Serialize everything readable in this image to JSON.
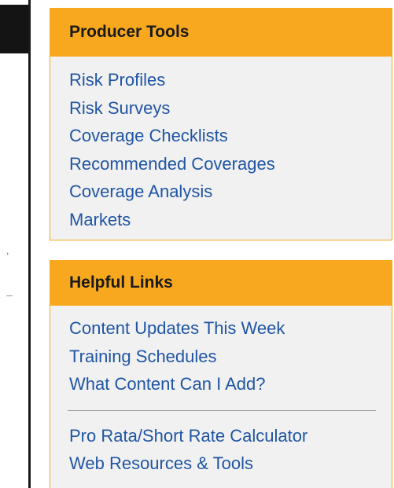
{
  "producer_tools": {
    "title": "Producer Tools",
    "links": [
      "Risk Profiles",
      "Risk Surveys",
      "Coverage Checklists",
      "Recommended Coverages",
      "Coverage Analysis",
      "Markets"
    ]
  },
  "helpful_links": {
    "title": "Helpful Links",
    "links_group_1": [
      "Content Updates This Week",
      "Training Schedules",
      "What Content Can I Add?"
    ],
    "links_group_2": [
      "Pro Rata/Short Rate Calculator",
      "Web Resources & Tools"
    ]
  },
  "left_column": {
    "comma_mark": ","
  },
  "colors": {
    "header_bg": "#f8a81e",
    "panel_bg": "#f1f1f1",
    "link": "#1f55a3",
    "border": "#f7a81b"
  }
}
